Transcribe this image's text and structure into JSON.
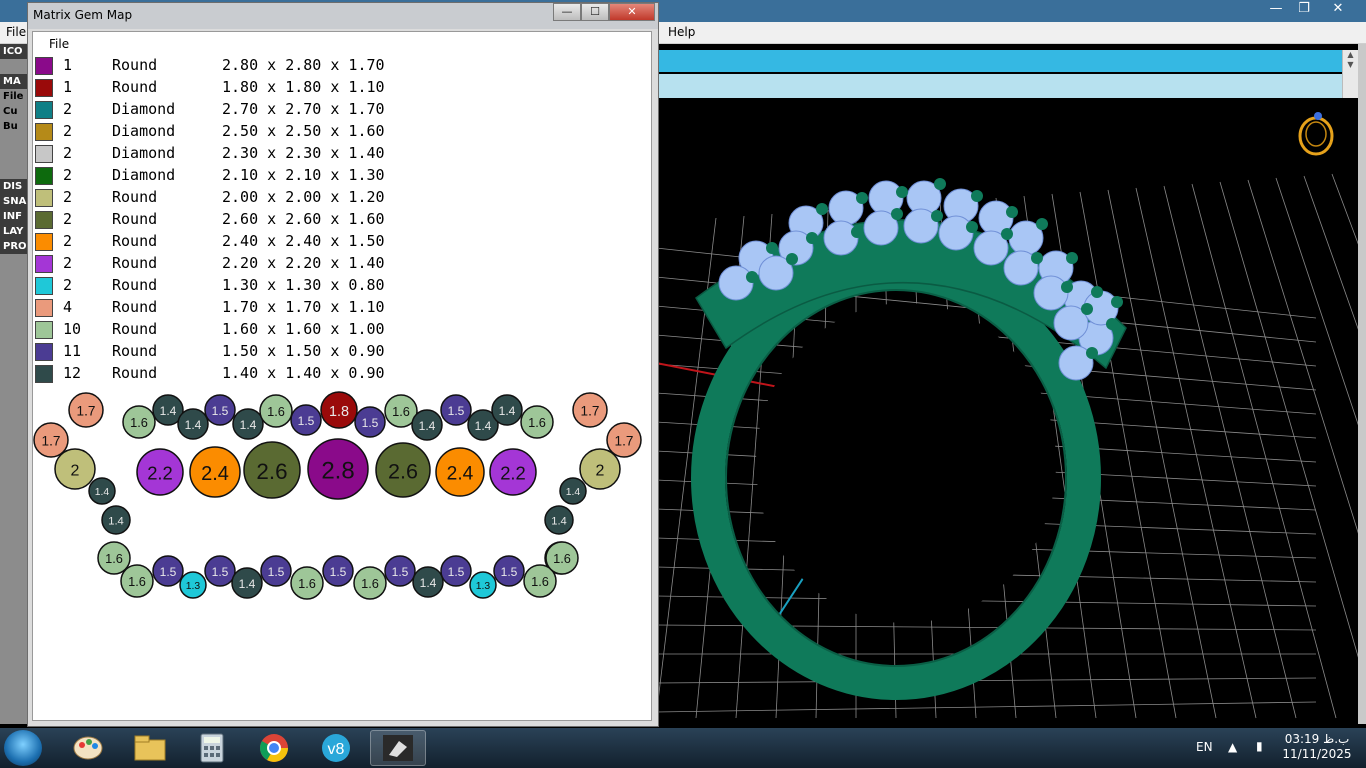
{
  "background_app": {
    "menu_left": "File",
    "menu_help": "Help",
    "left_panel_items": [
      "ICO",
      "",
      "MA",
      "File",
      "Cu",
      "Bu",
      "",
      "",
      "",
      "DIS",
      "SNA",
      "INF",
      "LAY",
      "PRO"
    ]
  },
  "gem_map_window": {
    "title": "Matrix Gem Map",
    "menu_file": "File",
    "rows": [
      {
        "color": "#8a0a8a",
        "qty": "1",
        "shape": "Round",
        "size": "2.80 x 2.80 x 1.70"
      },
      {
        "color": "#9a0a0a",
        "qty": "1",
        "shape": "Round",
        "size": "1.80 x 1.80 x 1.10"
      },
      {
        "color": "#0f7f86",
        "qty": "2",
        "shape": "Diamond",
        "size": "2.70 x 2.70 x 1.70"
      },
      {
        "color": "#b58a18",
        "qty": "2",
        "shape": "Diamond",
        "size": "2.50 x 2.50 x 1.60"
      },
      {
        "color": "#c7c7c7",
        "qty": "2",
        "shape": "Diamond",
        "size": "2.30 x 2.30 x 1.40"
      },
      {
        "color": "#0d6a0d",
        "qty": "2",
        "shape": "Diamond",
        "size": "2.10 x 2.10 x 1.30"
      },
      {
        "color": "#bfbf7a",
        "qty": "2",
        "shape": "Round",
        "size": "2.00 x 2.00 x 1.20"
      },
      {
        "color": "#5a6a32",
        "qty": "2",
        "shape": "Round",
        "size": "2.60 x 2.60 x 1.60"
      },
      {
        "color": "#fb8c00",
        "qty": "2",
        "shape": "Round",
        "size": "2.40 x 2.40 x 1.50"
      },
      {
        "color": "#a436d6",
        "qty": "2",
        "shape": "Round",
        "size": "2.20 x 2.20 x 1.40"
      },
      {
        "color": "#1fc8d8",
        "qty": "2",
        "shape": "Round",
        "size": "1.30 x 1.30 x 0.80"
      },
      {
        "color": "#ea9a7c",
        "qty": "4",
        "shape": "Round",
        "size": "1.70 x 1.70 x 1.10"
      },
      {
        "color": "#9ec698",
        "qty": "10",
        "shape": "Round",
        "size": "1.60 x 1.60 x 1.00"
      },
      {
        "color": "#4b3c93",
        "qty": "11",
        "shape": "Round",
        "size": "1.50 x 1.50 x 0.90"
      },
      {
        "color": "#2f4a4a",
        "qty": "12",
        "shape": "Round",
        "size": "1.40 x 1.40 x 0.90"
      }
    ],
    "map_gems": [
      {
        "label": "1.7",
        "color": "#ea9a7c"
      },
      {
        "label": "1.6",
        "color": "#9ec698"
      },
      {
        "label": "1.4",
        "color": "#2f4a4a"
      },
      {
        "label": "1.4",
        "color": "#2f4a4a"
      },
      {
        "label": "1.5",
        "color": "#4b3c93"
      },
      {
        "label": "1.4",
        "color": "#2f4a4a"
      },
      {
        "label": "1.6",
        "color": "#9ec698"
      },
      {
        "label": "1.5",
        "color": "#4b3c93"
      },
      {
        "label": "1.8",
        "color": "#9a0a0a"
      },
      {
        "label": "1.5",
        "color": "#4b3c93"
      },
      {
        "label": "1.6",
        "color": "#9ec698"
      },
      {
        "label": "1.4",
        "color": "#2f4a4a"
      },
      {
        "label": "1.5",
        "color": "#4b3c93"
      },
      {
        "label": "1.4",
        "color": "#2f4a4a"
      },
      {
        "label": "1.4",
        "color": "#2f4a4a"
      },
      {
        "label": "1.6",
        "color": "#9ec698"
      },
      {
        "label": "1.7",
        "color": "#ea9a7c"
      },
      {
        "label": "1.7",
        "color": "#ea9a7c"
      },
      {
        "label": "1.7",
        "color": "#ea9a7c"
      },
      {
        "label": "2",
        "color": "#bfbf7a"
      },
      {
        "label": "2.2",
        "color": "#a436d6"
      },
      {
        "label": "2.4",
        "color": "#fb8c00"
      },
      {
        "label": "2.6",
        "color": "#5a6a32"
      },
      {
        "label": "2.8",
        "color": "#8a0a8a"
      },
      {
        "label": "2.6",
        "color": "#5a6a32"
      },
      {
        "label": "2.4",
        "color": "#fb8c00"
      },
      {
        "label": "2.2",
        "color": "#a436d6"
      },
      {
        "label": "2",
        "color": "#bfbf7a"
      },
      {
        "label": "1.4",
        "color": "#2f4a4a"
      },
      {
        "label": "1.4",
        "color": "#2f4a4a"
      },
      {
        "label": "1.4",
        "color": "#2f4a4a"
      },
      {
        "label": "1.4",
        "color": "#2f4a4a"
      },
      {
        "label": "1.6",
        "color": "#9ec698"
      },
      {
        "label": "1.6",
        "color": "#9ec698"
      },
      {
        "label": "1.6",
        "color": "#9ec698"
      },
      {
        "label": "1.5",
        "color": "#4b3c93"
      },
      {
        "label": "1.3",
        "color": "#1fc8d8"
      },
      {
        "label": "1.5",
        "color": "#4b3c93"
      },
      {
        "label": "1.4",
        "color": "#2f4a4a"
      },
      {
        "label": "1.5",
        "color": "#4b3c93"
      },
      {
        "label": "1.6",
        "color": "#9ec698"
      },
      {
        "label": "1.5",
        "color": "#4b3c93"
      },
      {
        "label": "1.6",
        "color": "#9ec698"
      },
      {
        "label": "1.5",
        "color": "#4b3c93"
      },
      {
        "label": "1.4",
        "color": "#2f4a4a"
      },
      {
        "label": "1.5",
        "color": "#4b3c93"
      },
      {
        "label": "1.3",
        "color": "#1fc8d8"
      },
      {
        "label": "1.5",
        "color": "#4b3c93"
      },
      {
        "label": "1.6",
        "color": "#9ec698"
      },
      {
        "label": "1.6",
        "color": "#9ec698"
      }
    ]
  },
  "viewport": {
    "ring_color": "#0f7a5a",
    "stone_color": "#a9c6f5",
    "grid_color": "#8a8a8a"
  },
  "taskbar": {
    "apps": [
      "start-orb",
      "paint-icon",
      "explorer-icon",
      "calculator-icon",
      "chrome-icon",
      "v8-icon",
      "matrix-icon"
    ],
    "language": "EN",
    "time": "03:19 ب.ظ",
    "date": "11/11/2025"
  }
}
